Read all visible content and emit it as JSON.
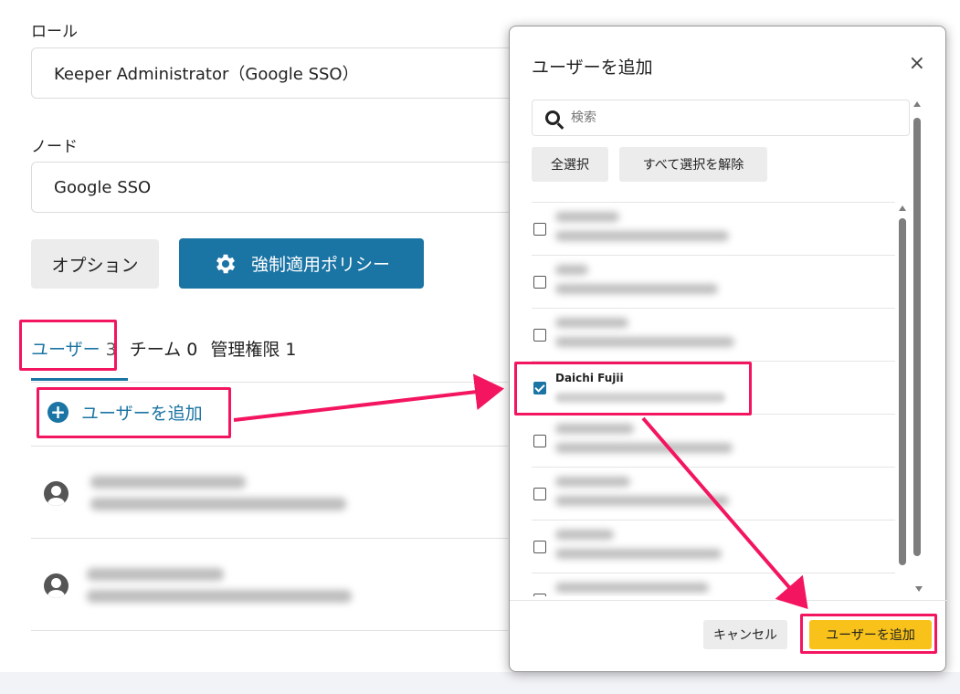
{
  "role": {
    "label": "ロール",
    "value": "Keeper Administrator（Google SSO）"
  },
  "node": {
    "label": "ノード",
    "value": "Google SSO"
  },
  "buttons": {
    "options": "オプション",
    "enforcement_policy": "強制適用ポリシー"
  },
  "tabs": [
    {
      "label": "ユーザー",
      "count": "3",
      "active": true
    },
    {
      "label": "チーム",
      "count": "0",
      "active": false
    },
    {
      "label": "管理権限",
      "count": "1",
      "active": false
    }
  ],
  "add_user_link": "ユーザーを追加",
  "modal": {
    "title": "ユーザーを追加",
    "close": "×",
    "search_placeholder": "検索",
    "select_all": "全選択",
    "deselect_all": "すべて選択を解除",
    "visible_user_name": "Daichi Fujii",
    "visible_user_checked": true,
    "cancel": "キャンセル",
    "add": "ユーザーを追加"
  },
  "colors": {
    "accent": "#1a74a4",
    "primary_yellow": "#f8c21a",
    "annotation": "#f3155f"
  }
}
